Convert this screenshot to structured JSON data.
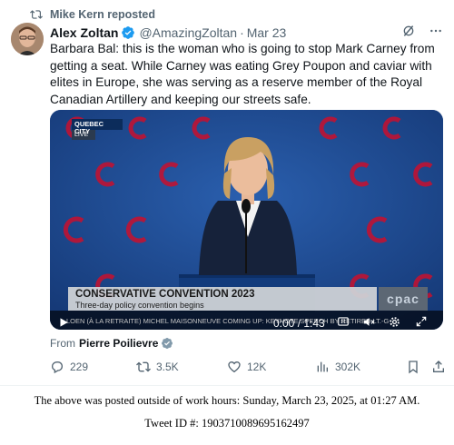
{
  "repost": {
    "label": "Mike Kern reposted",
    "icon": "repost-icon"
  },
  "author": {
    "name": "Alex Zoltan",
    "handle": "@AmazingZoltan",
    "separator": "·",
    "date": "Mar 23",
    "verified": true
  },
  "tweet": {
    "text": "Barbara Bal: this is the woman who is going to stop Mark Carney from getting a seat. While Carney was eating Grey Poupon and caviar with elites in Europe, she was serving as a reserve member of the Royal Canadian Artillery and keeping our streets safe."
  },
  "video": {
    "live_city": "QUEBEC CITY",
    "live_text": "LIVE",
    "lower_title": "CONSERVATIVE CONVENTION 2023",
    "lower_subtitle": "Three-day policy convention begins",
    "logo": "cpac",
    "ticker": "LOEN (À LA RETRAITE) MICHEL MAISONNEUVE      COMING UP: KEYNOTE SPEECH BY RETIRED LT.-G",
    "time": "0:00 / 1:43",
    "progress": 0,
    "accent_color": "#1d9bf0"
  },
  "from": {
    "prefix": "From",
    "name": "Pierre Poilievre"
  },
  "actions": {
    "replies": "229",
    "reposts": "3.5K",
    "likes": "12K",
    "views": "302K"
  },
  "footer": {
    "line1": "The above was posted outside of work hours: Sunday, March 23, 2025, at 01:27 AM.",
    "line2": "Tweet ID #: 1903710089695162497"
  }
}
